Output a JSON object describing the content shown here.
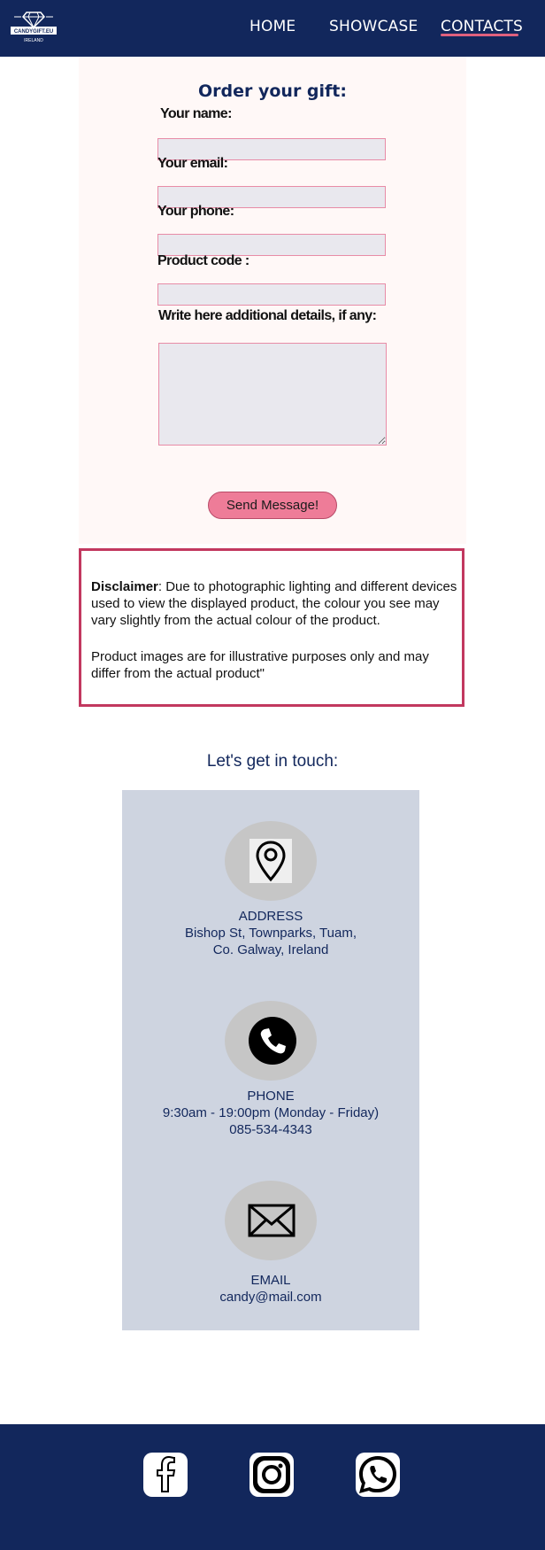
{
  "nav": {
    "logo_brand": "CANDYGIFT.EU",
    "logo_sub": "IRELAND",
    "home": "HOME",
    "showcase": "SHOWCASE",
    "contacts": "CONTACTS",
    "active": "CONTACTS",
    "accent": "#e0607e",
    "background": "#12275c"
  },
  "form": {
    "title": "Order your gift:",
    "name_label": "Your name:",
    "email_label": "Your email:",
    "phone_label": "Your phone:",
    "code_label": "Product code :",
    "details_label": "Write here additional details, if any:",
    "name_value": "",
    "email_value": "",
    "phone_value": "",
    "code_value": "",
    "details_value": "",
    "send_label": "Send Message!",
    "button_color": "#ee7c98",
    "field_border": "#e88ca7"
  },
  "disclaimer": {
    "bold": "Disclaimer",
    "text": ": Due to photographic lighting and different devices used to view the displayed product, the colour you see may vary slightly from the actual colour of the product.",
    "text2": "Product images are for illustrative purposes only and may differ from the actual product\"",
    "border_color": "#c2385f"
  },
  "contact": {
    "title": "Let's get in touch:",
    "address_label": "ADDRESS",
    "address_line1": "Bishop St, Townparks, Tuam,",
    "address_line2": "Co. Galway, Ireland",
    "address_icon": "location-pin-icon",
    "phone_label": "PHONE",
    "phone_hours": "9:30am - 19:00pm (Monday - Friday)",
    "phone_number": "085-534-4343",
    "phone_icon": "phone-icon",
    "email_label": "EMAIL",
    "email_value": "candy@mail.com",
    "email_icon": "envelope-icon"
  },
  "footer": {
    "icons": [
      "facebook-icon",
      "instagram-icon",
      "whatsapp-icon"
    ]
  }
}
